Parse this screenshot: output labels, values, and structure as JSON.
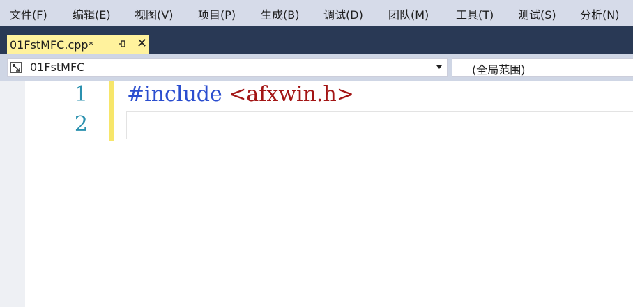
{
  "menu": {
    "items": [
      {
        "label": "文件(F)"
      },
      {
        "label": "编辑(E)"
      },
      {
        "label": "视图(V)"
      },
      {
        "label": "项目(P)"
      },
      {
        "label": "生成(B)"
      },
      {
        "label": "调试(D)"
      },
      {
        "label": "团队(M)"
      },
      {
        "label": "工具(T)"
      },
      {
        "label": "测试(S)"
      },
      {
        "label": "分析(N)"
      }
    ]
  },
  "tab": {
    "title": "01FstMFC.cpp*",
    "pin_icon": "pin-icon",
    "close_icon": "close-icon",
    "close_glyph": "✕",
    "color": "#fff29d"
  },
  "navigation": {
    "project": "01FstMFC",
    "scope": "(全局范围)"
  },
  "editor": {
    "lines": [
      {
        "number": "1",
        "directive": "#include",
        "header": "<afxwin.h>"
      },
      {
        "number": "2",
        "directive": "",
        "header": ""
      }
    ],
    "line_number_color": "#2b91af",
    "keyword_color": "#2b4ecf",
    "string_color": "#a31515",
    "change_bar_color": "#f7e66a"
  }
}
